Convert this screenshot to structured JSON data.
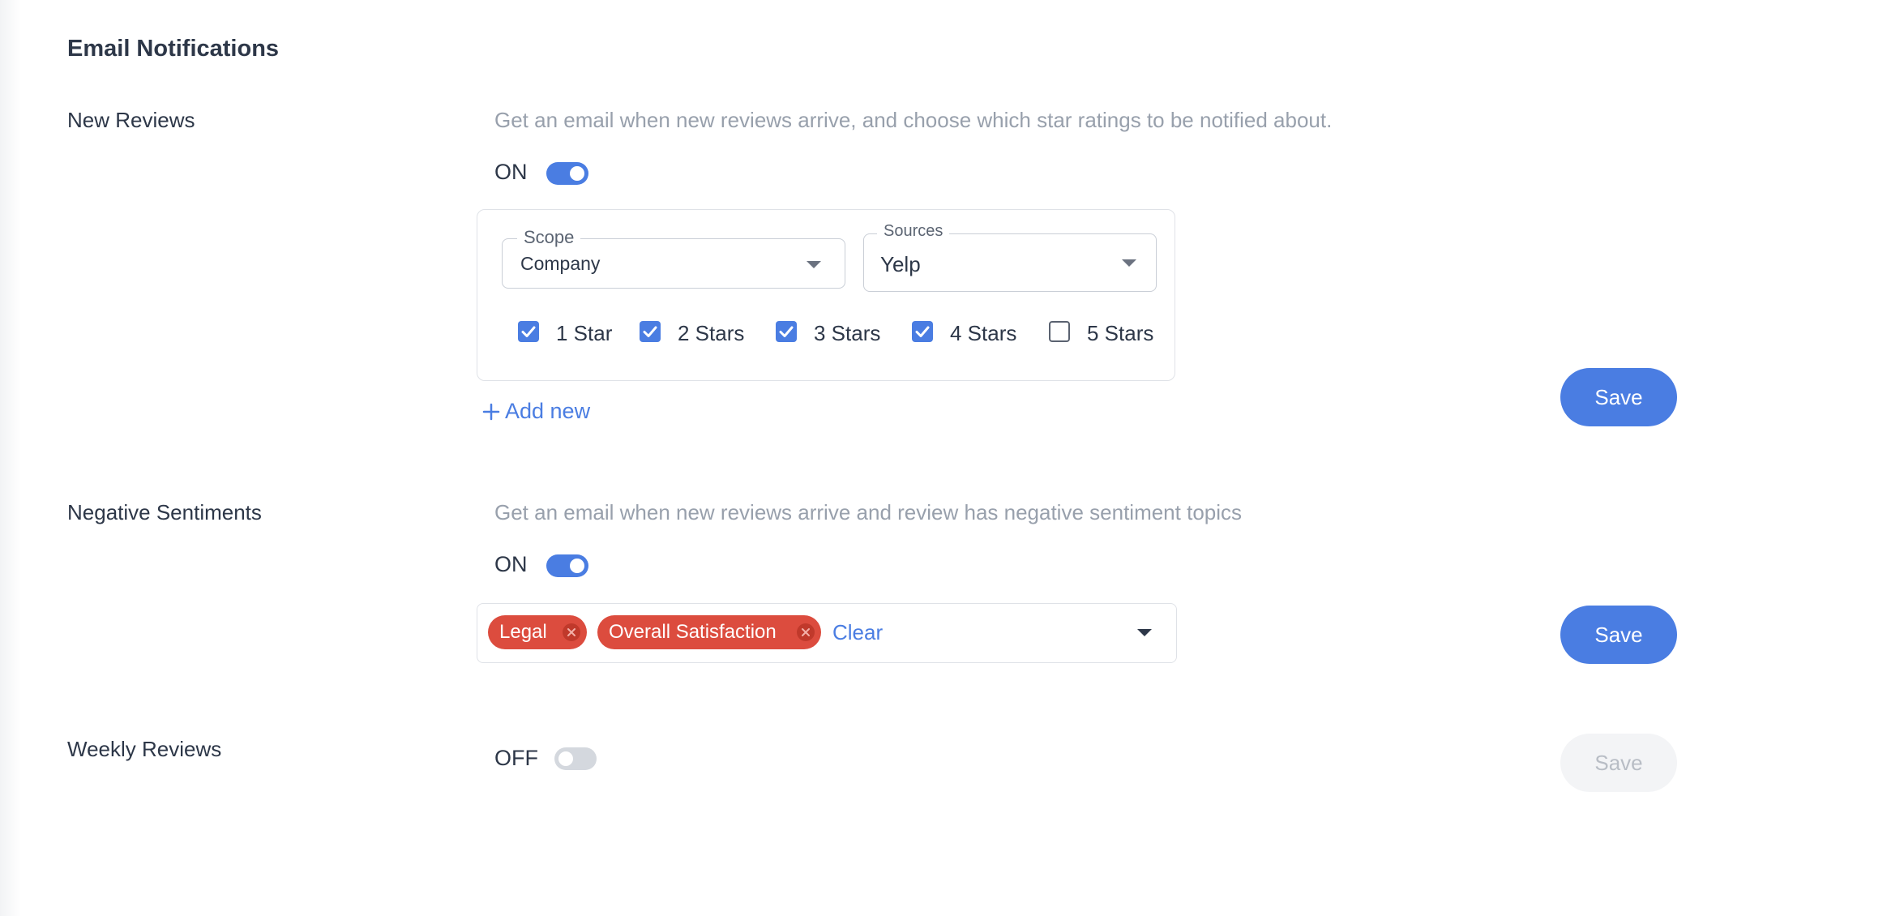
{
  "section_title": "Email Notifications",
  "new_reviews": {
    "label": "New Reviews",
    "description": "Get an email when new reviews arrive, and choose which star ratings to be notified about.",
    "toggle_label": "ON",
    "toggle_on": true,
    "scope": {
      "label": "Scope",
      "value": "Company"
    },
    "sources": {
      "label": "Sources",
      "value": "Yelp"
    },
    "stars": [
      {
        "label": "1 Star",
        "checked": true
      },
      {
        "label": "2 Stars",
        "checked": true
      },
      {
        "label": "3 Stars",
        "checked": true
      },
      {
        "label": "4 Stars",
        "checked": true
      },
      {
        "label": "5 Stars",
        "checked": false
      }
    ],
    "add_new": "Add new",
    "save_label": "Save"
  },
  "negative_sentiments": {
    "label": "Negative Sentiments",
    "description": "Get an email when new reviews arrive and review has negative sentiment topics",
    "toggle_label": "ON",
    "toggle_on": true,
    "chips": [
      "Legal",
      "Overall Satisfaction"
    ],
    "clear_label": "Clear",
    "save_label": "Save"
  },
  "weekly_reviews": {
    "label": "Weekly Reviews",
    "toggle_label": "OFF",
    "toggle_on": false,
    "save_label": "Save",
    "save_disabled": true
  },
  "colors": {
    "accent": "#4a7de2",
    "chip": "#dc4c3e",
    "text": "#2d3748",
    "muted": "#98a0ac"
  }
}
